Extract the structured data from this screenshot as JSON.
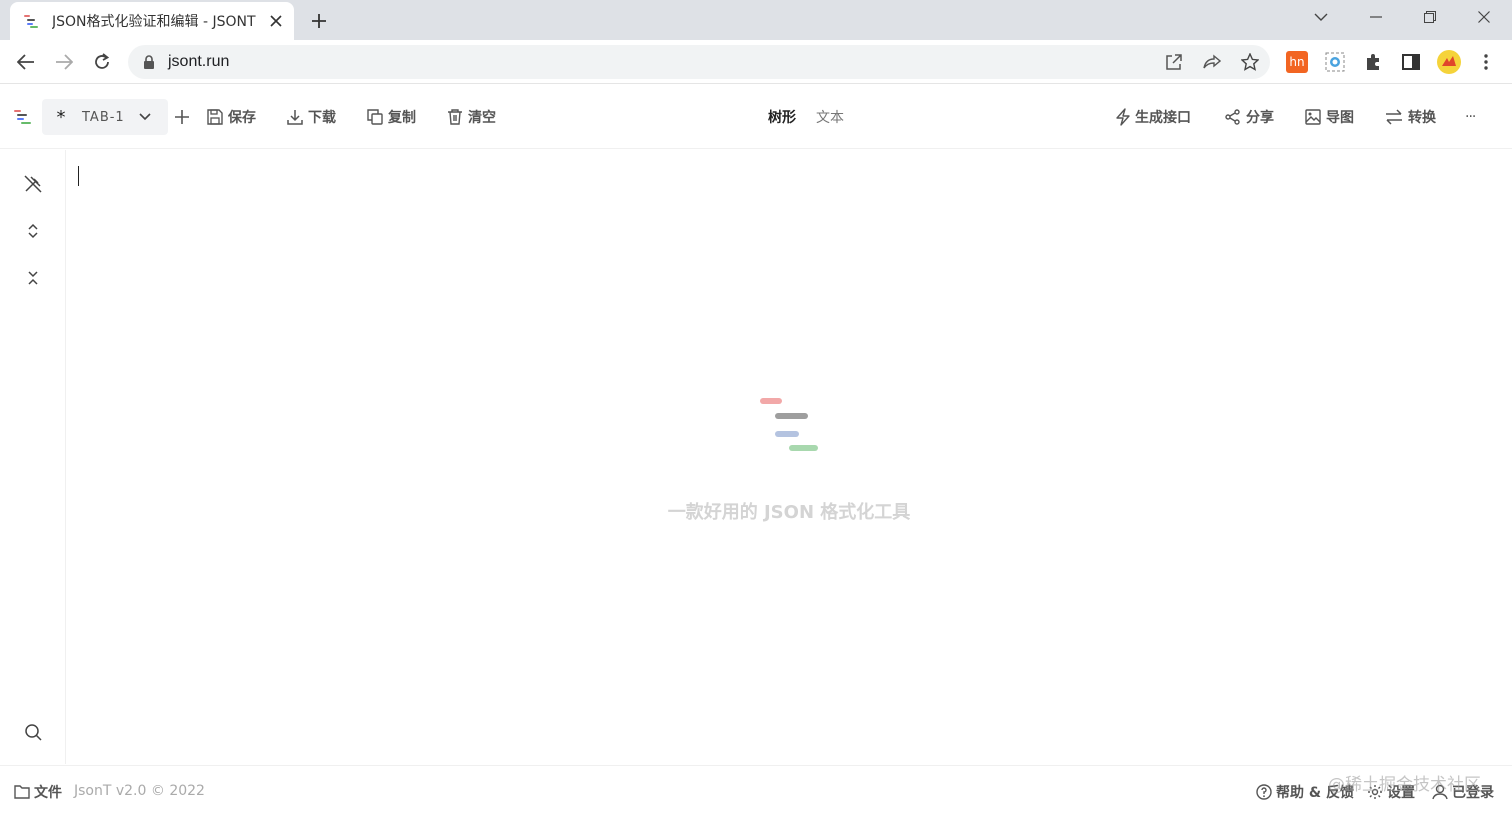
{
  "browser": {
    "tab_title": "JSON格式化验证和编辑 - JSONT",
    "url": "jsont.run",
    "extension_hn_label": "hn"
  },
  "toolbar": {
    "tab_name": "TAB-1",
    "tab_marker": "*",
    "save": "保存",
    "download": "下载",
    "copy": "复制",
    "clear": "清空",
    "view_tree": "树形",
    "view_text": "文本",
    "generate_api": "生成接口",
    "share": "分享",
    "export_image": "导图",
    "convert": "转换",
    "more": "···"
  },
  "editor": {
    "empty_text": "一款好用的 JSON 格式化工具"
  },
  "footer": {
    "files": "文件",
    "version": "JsonT v2.0 © 2022",
    "help": "帮助 & 反馈",
    "settings": "设置",
    "login": "已登录",
    "watermark": "@稀土掘金技术社区"
  },
  "colors": {
    "logo_red": "#f2a8a8",
    "logo_gray": "#9e9e9e",
    "logo_blue": "#b4c3e0",
    "logo_green": "#a8d8ae",
    "ext_hn": "#f26522",
    "tabstrip_bg": "#dee1e6"
  }
}
